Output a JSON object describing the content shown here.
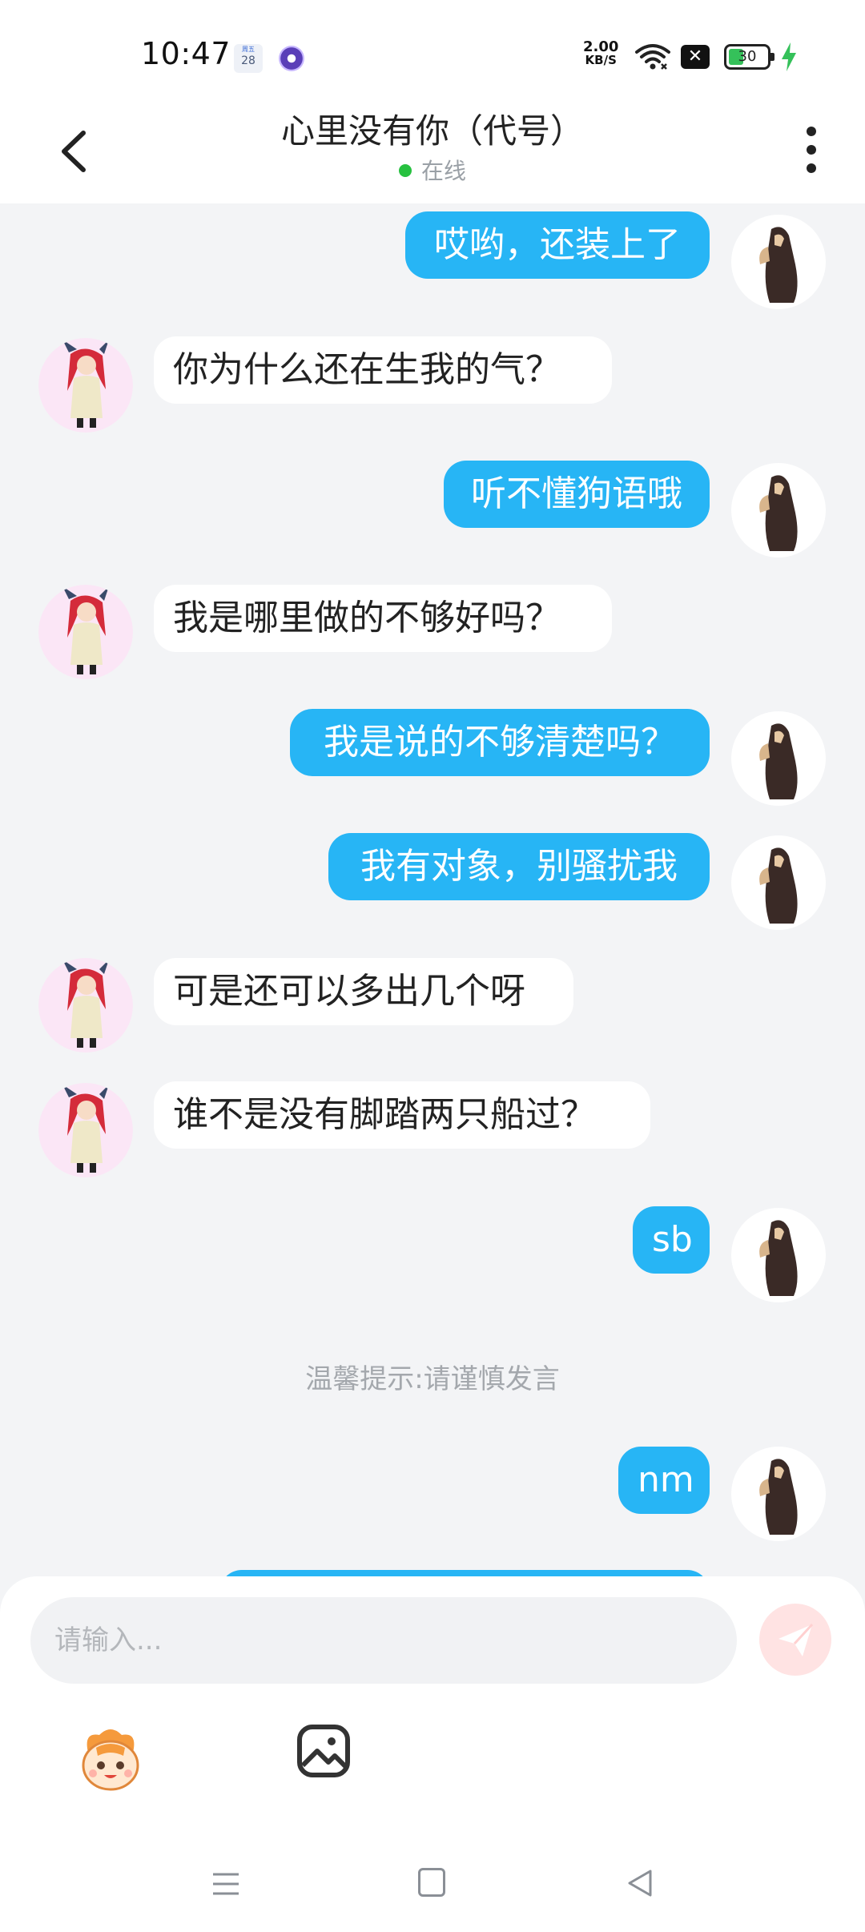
{
  "status_bar": {
    "time": "10:47",
    "calendar_label": "周五",
    "calendar_day": "28",
    "net_speed_value": "2.00",
    "net_speed_unit": "KB/S",
    "battery": "30",
    "colors": {
      "battery_fill": "#35c15a",
      "bolt": "#35c15a"
    }
  },
  "header": {
    "title": "心里没有你（代号）",
    "status": "在线",
    "status_dot_color": "#27c140"
  },
  "chat": {
    "messages": [
      {
        "side": "out",
        "text": "哎哟，还装上了"
      },
      {
        "side": "in",
        "text": "你为什么还在生我的气？"
      },
      {
        "side": "out",
        "text": "听不懂狗语哦"
      },
      {
        "side": "in",
        "text": "我是哪里做的不够好吗？"
      },
      {
        "side": "out",
        "text": "我是说的不够清楚吗？"
      },
      {
        "side": "out",
        "text": "我有对象，别骚扰我"
      },
      {
        "side": "in",
        "text": "可是还可以多出几个呀"
      },
      {
        "side": "in",
        "text": "谁不是没有脚踏两只船过？"
      },
      {
        "side": "out",
        "text": "sb"
      },
      {
        "side": "out",
        "text": "nm"
      }
    ],
    "tip": "温馨提示:请谨慎发言",
    "colors": {
      "outgoing_bubble": "#27b5f5",
      "incoming_bubble": "#ffffff",
      "background": "#f3f4f6"
    }
  },
  "composer": {
    "placeholder": "请输入...",
    "send_icon": "paper-plane-icon",
    "emoji_icon": "emoji-mascot-icon",
    "image_icon": "image-icon"
  },
  "nav": {
    "menu_icon": "menu-icon",
    "home_icon": "home-square-icon",
    "back_icon": "back-triangle-icon"
  }
}
